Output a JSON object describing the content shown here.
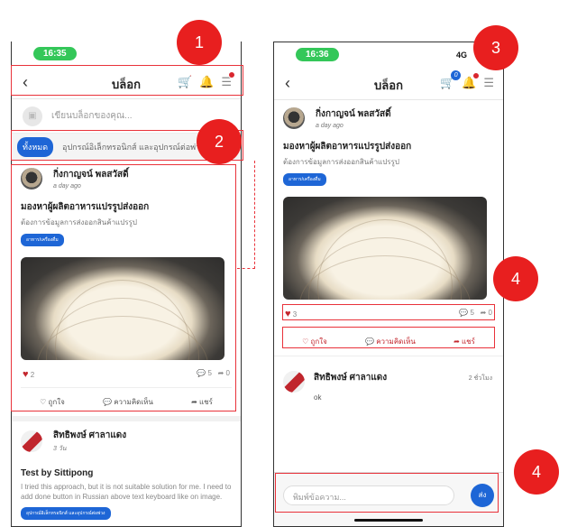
{
  "left_phone": {
    "time": "16:35",
    "title": "บล็อก",
    "compose_placeholder": "เขียนบล็อกของคุณ...",
    "filters": [
      "ทั้งหมด",
      "อุปกรณ์อิเล็กทรอนิกส์ และอุปกรณ์ต่อพ่วง"
    ],
    "post": {
      "author": "กิ่งกาญจน์ พลสวัสดิ์",
      "time": "a day ago",
      "title": "มองหาผู้ผลิตอาหารแปรรูปส่งออก",
      "desc": "ต้องการข้อมูลการส่งออกสินค้าแปรรูป",
      "tag": "อาหาร/เครื่องดื่ม",
      "likes": "2",
      "comments": "5",
      "shares": "0",
      "like_label": "ถูกใจ",
      "comment_label": "ความคิดเห็น",
      "share_label": "แชร์"
    },
    "post2": {
      "author": "สิทธิพงษ์ ศาลาแดง",
      "time": "3 วัน",
      "title": "Test by Sittipong",
      "text": "I tried this approach, but it is not suitable solution for me. I need to add done button in Russian above text keyboard like on image.",
      "tag": "อุปกรณ์อิเล็กทรอนิกส์ และอุปกรณ์ต่อพ่วง"
    }
  },
  "right_phone": {
    "time": "16:36",
    "signal": "4G",
    "title": "บล็อก",
    "cart_badge": "0",
    "post": {
      "author": "กิ่งกาญจน์ พลสวัสดิ์",
      "time": "a day ago",
      "title": "มองหาผู้ผลิตอาหารแปรรูปส่งออก",
      "desc": "ต้องการข้อมูลการส่งออกสินค้าแปรรูป",
      "tag": "อาหาร/เครื่องดื่ม",
      "likes": "3",
      "comments": "5",
      "shares": "0",
      "like_label": "ถูกใจ",
      "comment_label": "ความคิดเห็น",
      "share_label": "แชร์"
    },
    "comment": {
      "author": "สิทธิพงษ์ ศาลาแดง",
      "time": "2 ชั่วโมง",
      "text": "ok"
    },
    "input_placeholder": "พิมพ์ข้อความ...",
    "send_label": "ส่ง"
  },
  "callouts": [
    "1",
    "2",
    "3",
    "4",
    "4"
  ]
}
